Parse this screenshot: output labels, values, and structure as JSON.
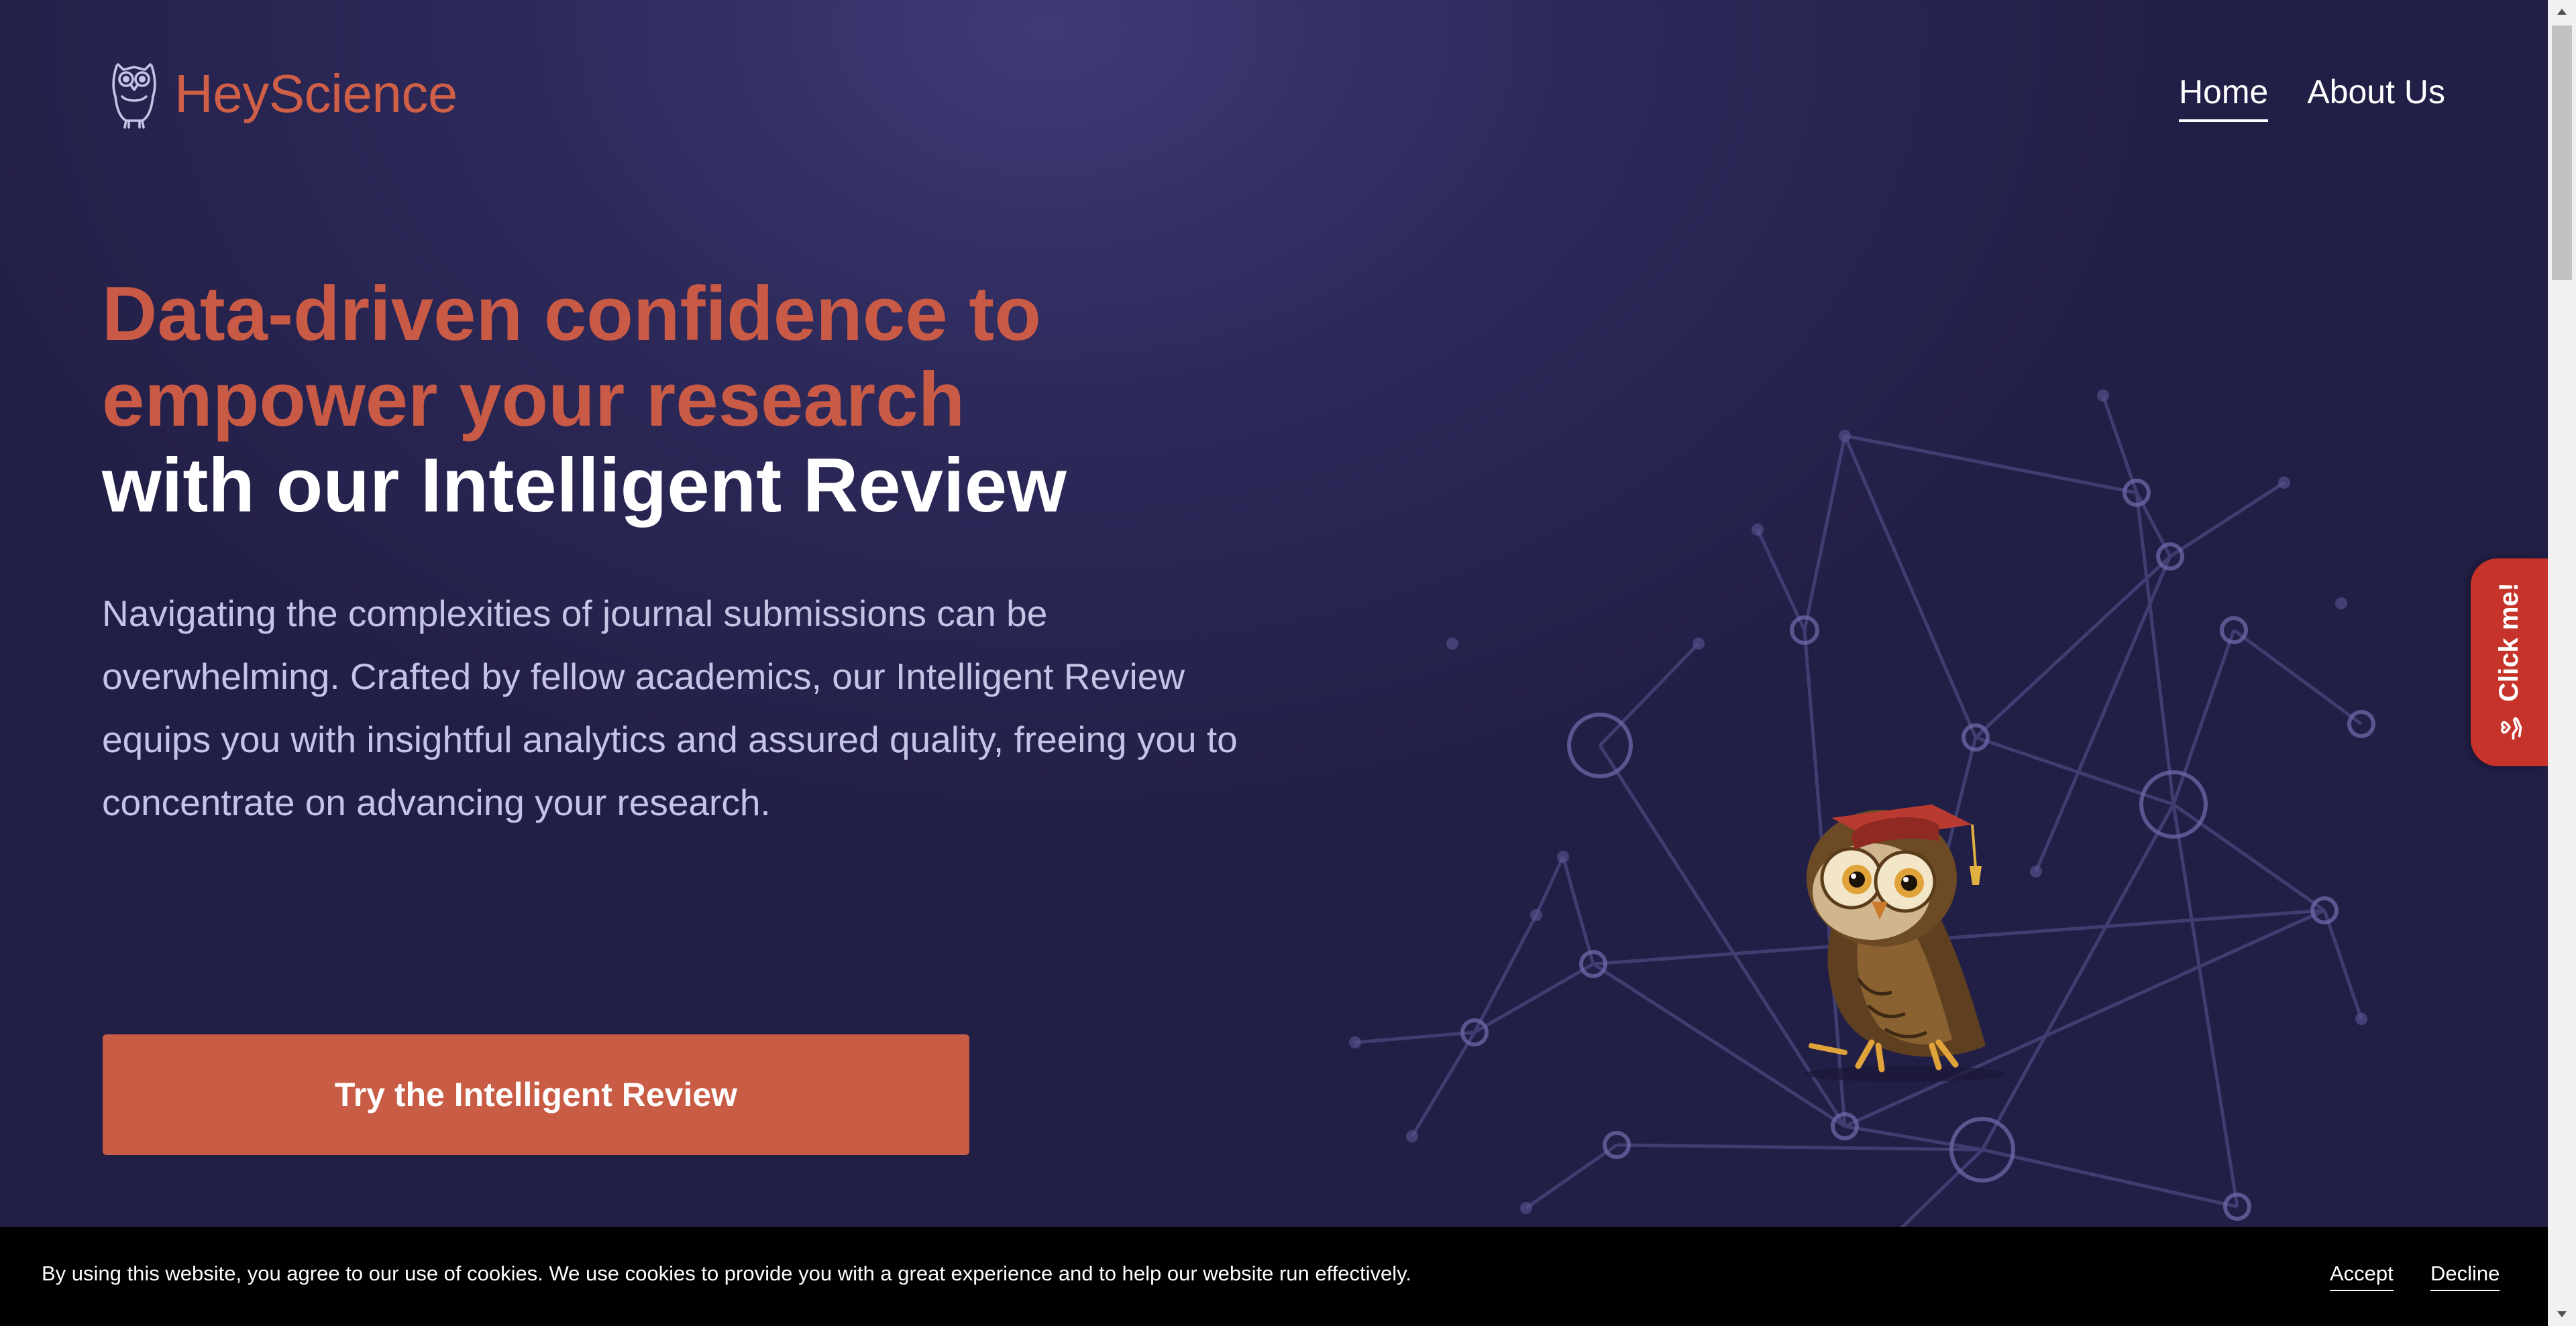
{
  "brand": {
    "name": "HeyScience",
    "logo_icon": "owl-logo-icon"
  },
  "nav": {
    "items": [
      {
        "label": "Home",
        "active": true
      },
      {
        "label": "About Us",
        "active": false
      }
    ]
  },
  "hero": {
    "title_line1": "Data-driven confidence to",
    "title_line2": "empower your research",
    "title_line3": "with our Intelligent Review",
    "description": "Navigating the complexities of journal submissions can be overwhelming. Crafted by fellow academics, our Intelligent Review equips you with insightful analytics and assured quality, freeing you to concentrate on advancing your research.",
    "cta_label": "Try the Intelligent Review"
  },
  "side_tab": {
    "label": "Click me!",
    "icon": "hand-heart-icon"
  },
  "cookie_banner": {
    "text": "By using this website, you agree to our use of cookies. We use cookies to provide you with a great experience and to help our website run effectively.",
    "accept_label": "Accept",
    "decline_label": "Decline"
  },
  "colors": {
    "accent": "#c85c44",
    "background": "#2d2a5b",
    "side_tab": "#c6332a",
    "muted_text": "#c7c3e6"
  }
}
